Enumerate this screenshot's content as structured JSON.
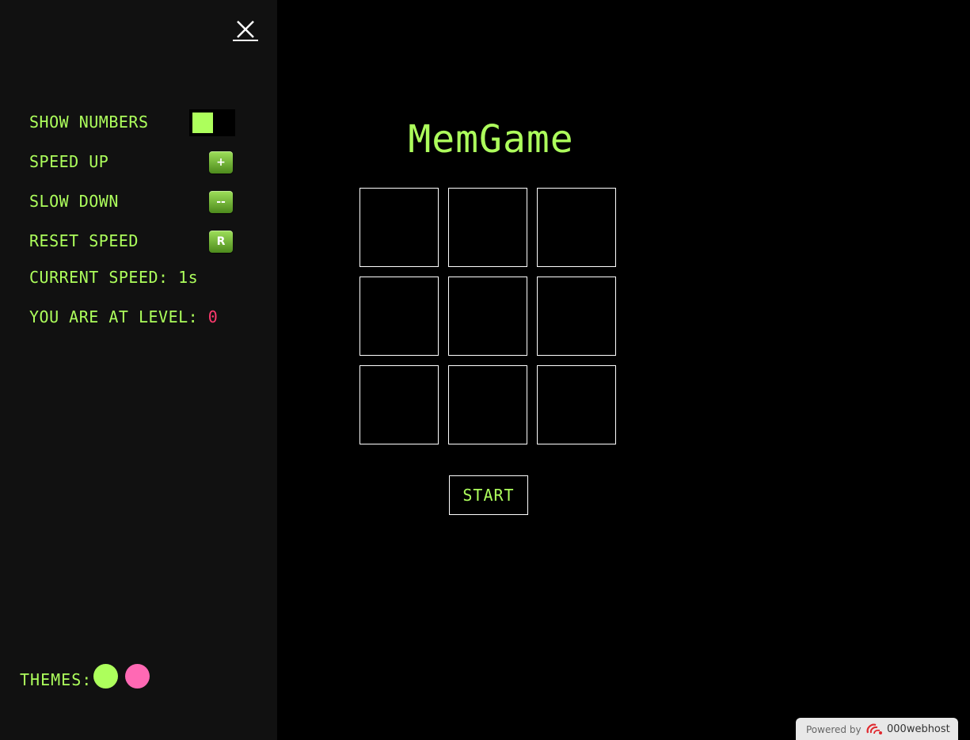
{
  "sidebar": {
    "close_icon": "close-icon",
    "show_numbers": {
      "label": "SHOW NUMBERS",
      "enabled": true
    },
    "speed_up": {
      "label": "SPEED UP",
      "button": "+"
    },
    "slow_down": {
      "label": "SLOW DOWN",
      "button": "--"
    },
    "reset_speed": {
      "label": "RESET SPEED",
      "button": "R"
    },
    "current_speed": {
      "label": "CURRENT SPEED:",
      "value": "1s"
    },
    "level": {
      "label": "YOU ARE AT LEVEL:",
      "value": "0"
    },
    "themes": {
      "label": "THEMES:",
      "options": [
        {
          "name": "green",
          "color": "#adff5c"
        },
        {
          "name": "pink",
          "color": "#ff69b4"
        }
      ]
    }
  },
  "game": {
    "title": "MemGame",
    "grid_cells": 9,
    "start_label": "START"
  },
  "footer": {
    "powered_by": "Powered by",
    "brand": "000webhost"
  },
  "colors": {
    "accent": "#adff5c",
    "level_value": "#ff3a6e",
    "sidebar_bg": "#111111",
    "page_bg": "#000000"
  }
}
